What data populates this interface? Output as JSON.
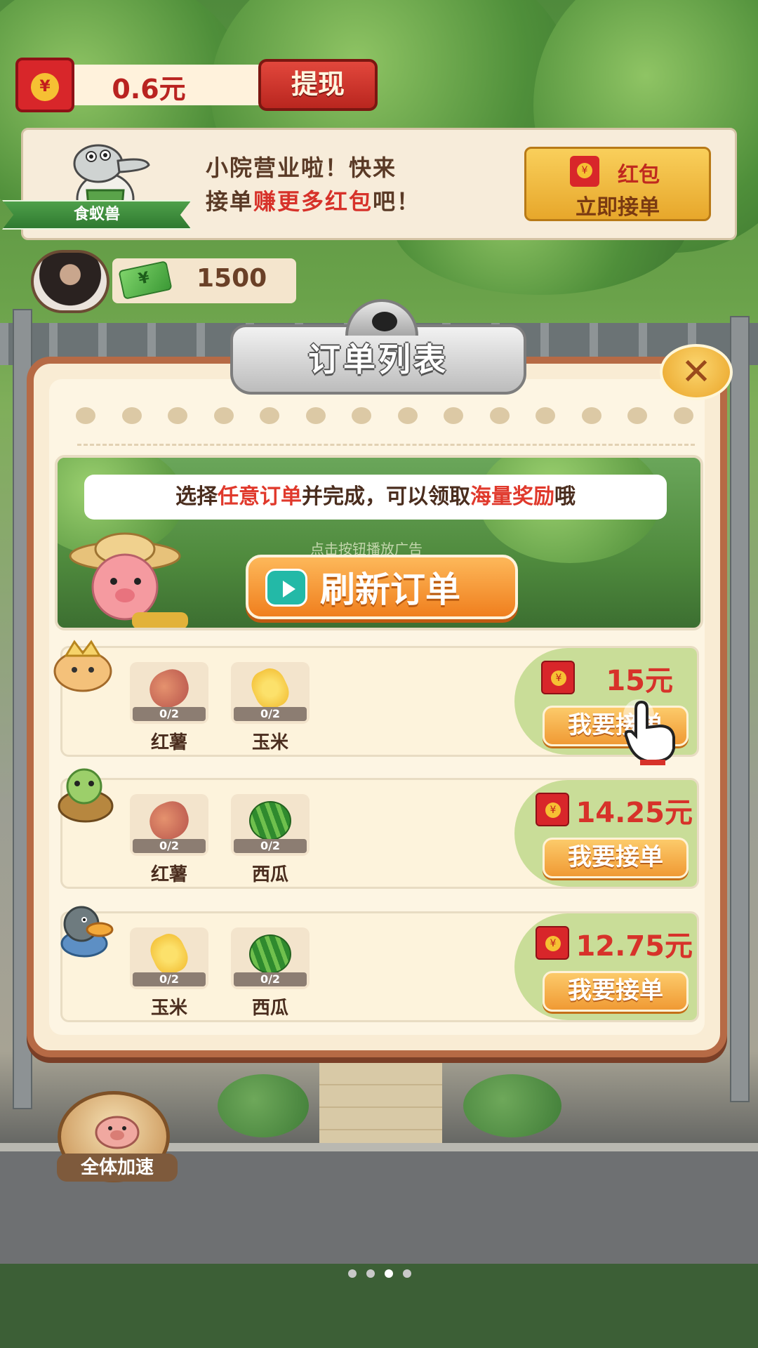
{
  "top_bar": {
    "balance": "0.6元",
    "withdraw_label": "提现"
  },
  "banner": {
    "character_label": "食蚁兽",
    "message_line1": "小院营业啦！快来",
    "message_line2_a": "接单",
    "message_line2_b": "赚更多红包",
    "message_line2_c": "吧！",
    "button_top": "红包",
    "button_bottom": "立即接单"
  },
  "player": {
    "cash": "1500"
  },
  "panel": {
    "title": "订单列表",
    "close_symbol": "✕",
    "tip_a": "选择",
    "tip_b": "任意订单",
    "tip_c": "并完成，可以领取",
    "tip_d": "海量奖励",
    "tip_e": "哦",
    "ad_hint": "点击按钮播放广告",
    "refresh_label": "刷新订单"
  },
  "orders": [
    {
      "items": [
        {
          "name": "红薯",
          "icon": "sweet-potato-icon",
          "count": "0/2"
        },
        {
          "name": "玉米",
          "icon": "corn-icon",
          "count": "0/2"
        }
      ],
      "reward": "15元",
      "accept_label": "我要接单"
    },
    {
      "items": [
        {
          "name": "红薯",
          "icon": "sweet-potato-icon",
          "count": "0/2"
        },
        {
          "name": "西瓜",
          "icon": "watermelon-icon",
          "count": "0/2"
        }
      ],
      "reward": "14.25元",
      "accept_label": "我要接单"
    },
    {
      "items": [
        {
          "name": "玉米",
          "icon": "corn-icon",
          "count": "0/2"
        },
        {
          "name": "西瓜",
          "icon": "watermelon-icon",
          "count": "0/2"
        }
      ],
      "reward": "12.75元",
      "accept_label": "我要接单"
    }
  ],
  "speedup": {
    "label": "全体加速"
  },
  "pager": {
    "count": 4,
    "active": 3
  },
  "colors": {
    "accent_red": "#d7322a",
    "button_orange": "#f09a34",
    "panel_border": "#b66a45"
  }
}
